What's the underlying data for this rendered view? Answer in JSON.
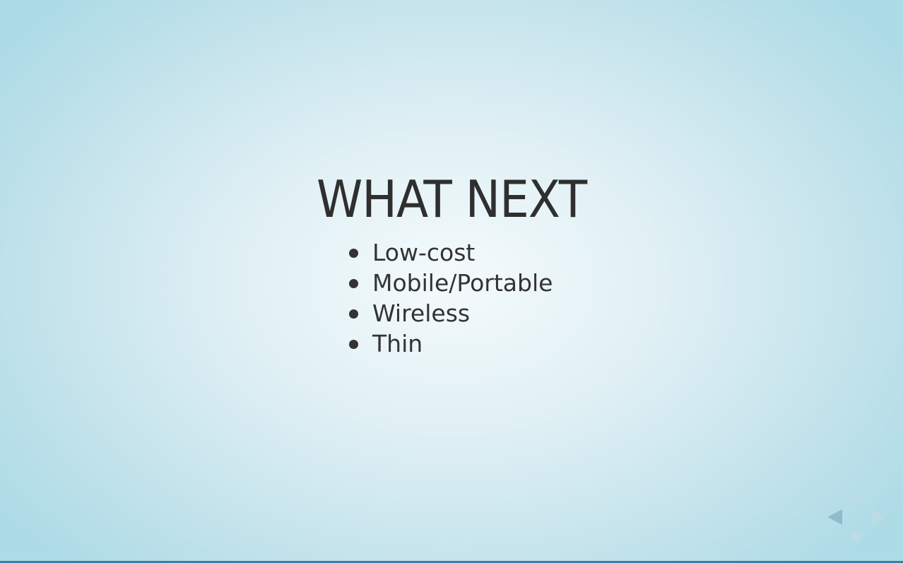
{
  "slide": {
    "title": "WHAT NEXT",
    "bullets": [
      "Low-cost",
      "Mobile/Portable",
      "Wireless",
      "Thin"
    ]
  },
  "controls": {
    "up": {
      "icon": "arrow-up-icon",
      "enabled": false
    },
    "down": {
      "icon": "arrow-down-icon",
      "enabled": false
    },
    "left": {
      "icon": "arrow-left-icon",
      "enabled": true
    },
    "right": {
      "icon": "arrow-right-icon",
      "enabled": false
    }
  },
  "progress": {
    "fraction": 1.0,
    "color": "#3b7fa8"
  },
  "theme": {
    "background_center": "#f4fafc",
    "background_edge": "#addbe6",
    "text_color": "#333333"
  }
}
